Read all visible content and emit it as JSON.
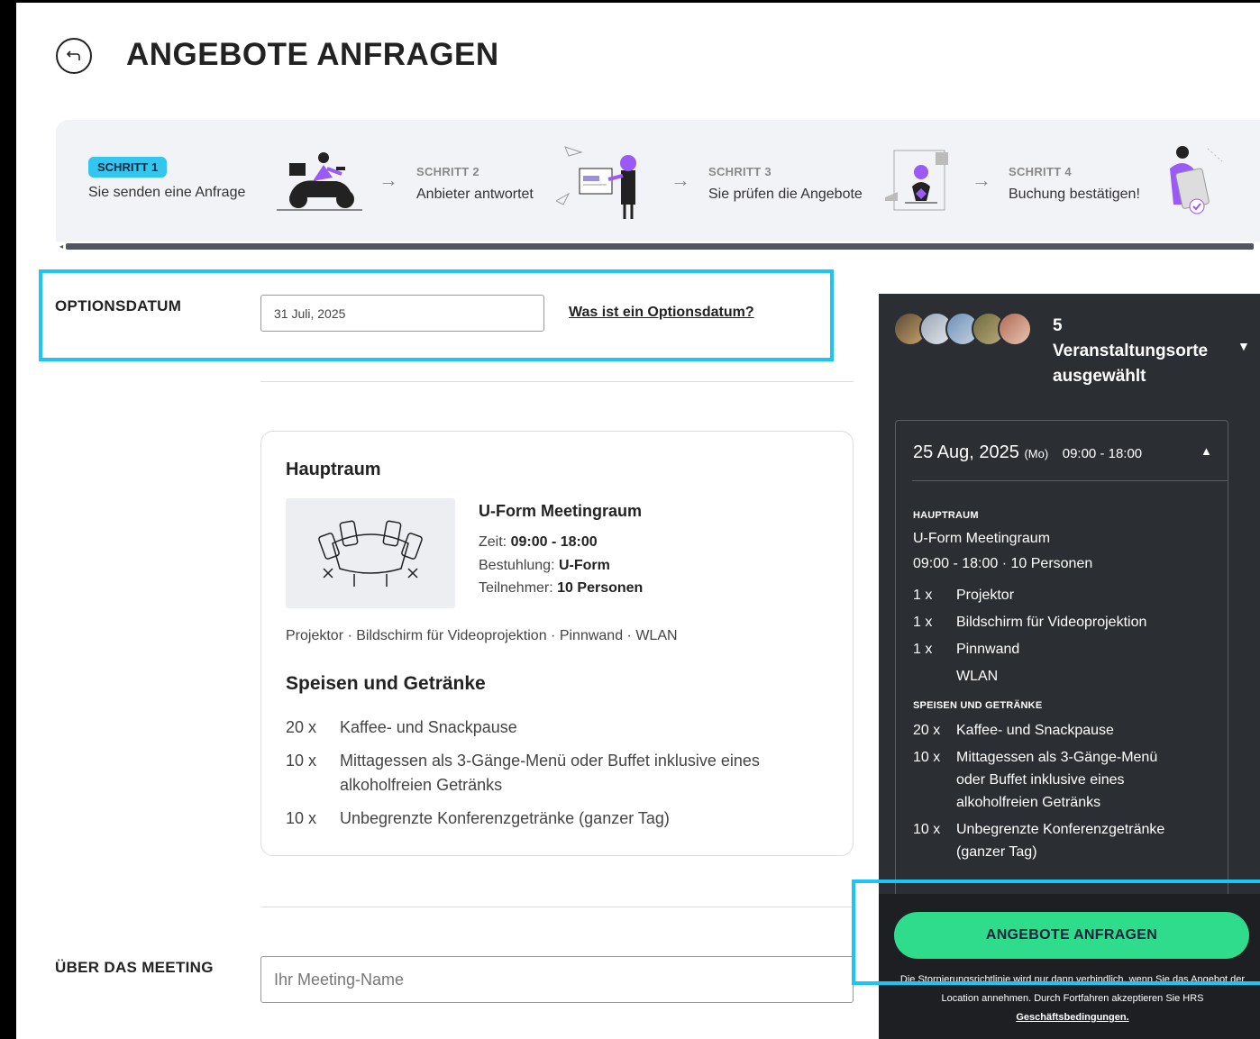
{
  "header": {
    "title": "ANGEBOTE ANFRAGEN",
    "back_icon": "back-arrow-icon"
  },
  "steps": [
    {
      "label": "SCHRITT 1",
      "text": "Sie senden eine Anfrage",
      "active": true
    },
    {
      "label": "SCHRITT 2",
      "text": "Anbieter antwortet",
      "active": false
    },
    {
      "label": "SCHRITT 3",
      "text": "Sie prüfen die Angebote",
      "active": false
    },
    {
      "label": "SCHRITT 4",
      "text": "Buchung bestätigen!",
      "active": false
    }
  ],
  "optionsdatum": {
    "label": "OPTIONSDATUM",
    "value": "31 Juli, 2025",
    "help_link": "Was ist ein Optionsdatum?"
  },
  "room_card": {
    "title": "Hauptraum",
    "room_name": "U-Form Meetingraum",
    "time_label": "Zeit:",
    "time_value": "09:00 - 18:00",
    "seating_label": "Bestuhlung:",
    "seating_value": "U-Form",
    "participants_label": "Teilnehmer:",
    "participants_value": "10 Personen",
    "equipment": "Projektor · Bildschirm für Videoprojektion · Pinnwand · WLAN",
    "fb_title": "Speisen und Getränke",
    "fb_items": [
      {
        "qty": "20 x",
        "name": "Kaffee- und Snackpause"
      },
      {
        "qty": "10 x",
        "name": "Mittagessen als 3-Gänge-Menü oder Buffet inklusive eines alkoholfreien Getränks"
      },
      {
        "qty": "10 x",
        "name": "Unbegrenzte Konferenzgetränke (ganzer Tag)"
      }
    ]
  },
  "about": {
    "label": "ÜBER DAS MEETING",
    "placeholder": "Ihr Meeting-Name"
  },
  "panel": {
    "venue_count": "5",
    "venue_text_1": "Veranstaltungsorte",
    "venue_text_2": "ausgewählt",
    "date": "25 Aug, 2025",
    "weekday": "(Mo)",
    "time": "09:00 - 18:00",
    "room_section": "HAUPTRAUM",
    "room_name": "U-Form Meetingraum",
    "room_detail": "09:00 - 18:00 · 10 Personen",
    "equipment": [
      {
        "qty": "1 x",
        "name": "Projektor"
      },
      {
        "qty": "1 x",
        "name": "Bildschirm für Videoprojektion"
      },
      {
        "qty": "1 x",
        "name": "Pinnwand"
      },
      {
        "qty": "",
        "name": "WLAN"
      }
    ],
    "fb_section": "SPEISEN UND GETRÄNKE",
    "fb_items": [
      {
        "qty": "20 x",
        "name": "Kaffee- und Snackpause"
      },
      {
        "qty": "10 x",
        "name": "Mittagessen als 3-Gänge-Menü oder Buffet inklusive eines alkoholfreien Getränks"
      },
      {
        "qty": "10 x",
        "name": "Unbegrenzte Konferenzgetränke (ganzer Tag)"
      }
    ],
    "cta": "ANGEBOTE ANFRAGEN",
    "policy_text": "Die Stornierungsrichtlinie wird nur dann verbindlich, wenn Sie das Angebot der Location annehmen. Durch Fortfahren akzeptieren Sie HRS",
    "policy_link": "Geschäftsbedingungen."
  },
  "colors": {
    "accent_cyan": "#33c6ef",
    "cta_green": "#2fdc8c",
    "panel_bg": "#2b2e33",
    "highlight": "#1ec5f4",
    "illustration_purple": "#9b59f5"
  }
}
